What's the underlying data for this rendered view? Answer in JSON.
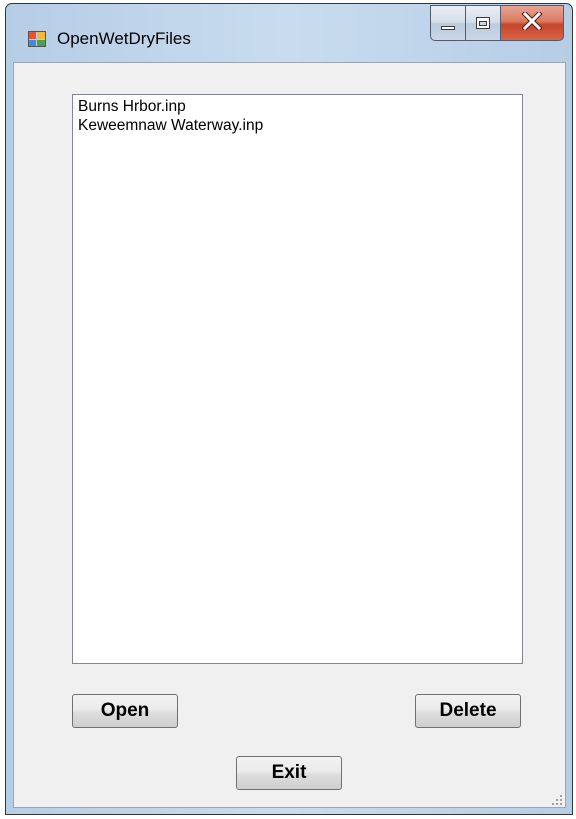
{
  "window": {
    "title": "OpenWetDryFiles",
    "icon": "windows-forms-app-icon",
    "caption_buttons": [
      "minimize-icon",
      "maximize-icon",
      "close-icon"
    ]
  },
  "file_list": {
    "items": [
      {
        "label": "Burns Hrbor.inp"
      },
      {
        "label": "Keweemnaw Waterway.inp"
      }
    ]
  },
  "buttons": {
    "open": "Open",
    "delete": "Delete",
    "exit": "Exit"
  },
  "colors": {
    "frame": "#c9dcef",
    "client": "#f0f0f0",
    "close_button": "#c4452a"
  }
}
